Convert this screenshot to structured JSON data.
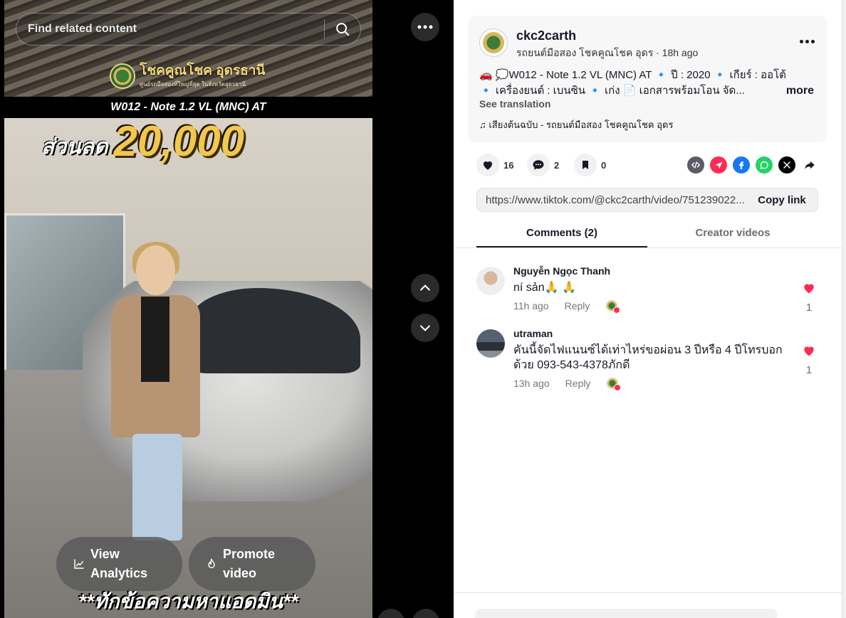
{
  "search": {
    "placeholder": "Find related content"
  },
  "video": {
    "logo_title": "โชคคูณโชค อุดรธานี",
    "logo_subtitle": "ศูนย์รถมือสองที่ใหญ่ที่สุด ในจังหวัดอุดรธานี",
    "model_title": "W012 - Note 1.2 VL (MNC) AT",
    "discount_label": "ส่วนลด",
    "discount_amount": "20,000",
    "bottom_caption": "**ทักข้อความหาแอดมิน**"
  },
  "overlay_buttons": {
    "analytics": "View Analytics",
    "promote": "Promote video"
  },
  "post": {
    "author": "ckc2carth",
    "subtitle": "รถยนต์มือสอง โชคคูณโชค อุดร · 18h ago",
    "description_line1": "🚗 💭W012 - Note 1.2 VL (MNC) AT 🔹 ปี : 2020 🔹 เกียร์ : ออโต้",
    "description_line2": "🔹 เครื่องยนต์ : เบนซิน 🔹 เก่ง 📄 เอกสารพร้อมโอน จัด...",
    "more_label": "more",
    "see_translation": "See translation",
    "music": "♫  เสียงต้นฉบับ - รถยนต์มือสอง โชคคูณโชค อุดร"
  },
  "actions": {
    "likes": "16",
    "comments": "2",
    "saves": "0"
  },
  "link": {
    "url": "https://www.tiktok.com/@ckc2carth/video/751239022...",
    "copy_label": "Copy link"
  },
  "tabs": [
    {
      "label": "Comments (2)",
      "active": true
    },
    {
      "label": "Creator videos",
      "active": false
    }
  ],
  "comments": [
    {
      "name": "Nguyễn Ngọc Thanh",
      "text": "ní sản🙏 🙏",
      "time": "11h ago",
      "reply": "Reply",
      "likes": "1"
    },
    {
      "name": "utraman",
      "text": "คันนี้จัดไฟแนนซ์ได้เท่าไหร่ขอผ่อน 3 ปีหรือ 4 ปีโทรบอกด้วย 093-543-4378ภักดี",
      "time": "13h ago",
      "reply": "Reply",
      "likes": "1"
    }
  ],
  "colors": {
    "accent_red": "#fe2c55",
    "text_dark": "#161823",
    "discount_gold": "#f2c64f"
  }
}
